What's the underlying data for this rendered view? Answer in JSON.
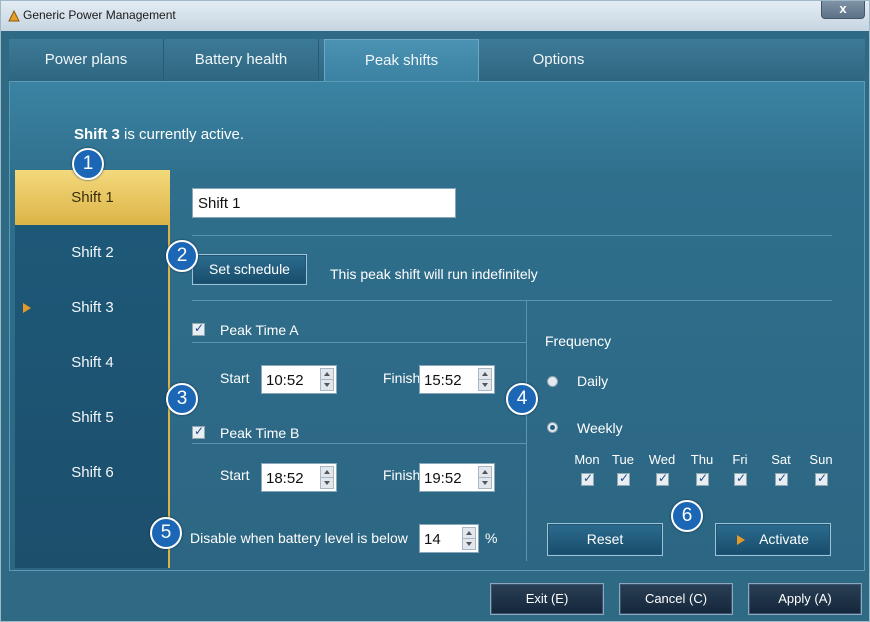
{
  "window": {
    "title": "Generic Power Management",
    "close_label": "x"
  },
  "tabs": [
    {
      "label": "Power plans"
    },
    {
      "label": "Battery health"
    },
    {
      "label": "Peak shifts"
    },
    {
      "label": "Options"
    }
  ],
  "status": {
    "shift_name": "Shift 3",
    "suffix": "is currently active."
  },
  "shifts": [
    {
      "label": "Shift 1"
    },
    {
      "label": "Shift 2"
    },
    {
      "label": "Shift 3"
    },
    {
      "label": "Shift 4"
    },
    {
      "label": "Shift 5"
    },
    {
      "label": "Shift 6"
    }
  ],
  "editor": {
    "name_value": "Shift 1",
    "set_schedule_label": "Set schedule",
    "schedule_note": "This peak shift will run indefinitely",
    "peak_a": {
      "label": "Peak Time A",
      "start_label": "Start",
      "start": "10:52",
      "finish_label": "Finish",
      "finish": "15:52"
    },
    "peak_b": {
      "label": "Peak Time B",
      "start_label": "Start",
      "start": "18:52",
      "finish_label": "Finish",
      "finish": "19:52"
    },
    "battery": {
      "label": "Disable when battery level is below",
      "value": "14",
      "unit": "%"
    },
    "frequency": {
      "label": "Frequency",
      "daily_label": "Daily",
      "weekly_label": "Weekly",
      "selected": "Weekly",
      "days": [
        "Mon",
        "Tue",
        "Wed",
        "Thu",
        "Fri",
        "Sat",
        "Sun"
      ]
    },
    "reset_label": "Reset",
    "activate_label": "Activate"
  },
  "footer": {
    "exit_label": "Exit (E)",
    "cancel_label": "Cancel (C)",
    "apply_label": "Apply (A)"
  },
  "callouts": [
    "1",
    "2",
    "3",
    "4",
    "5",
    "6"
  ],
  "colors": {
    "accent_gold": "#dcb447",
    "badge_blue": "#1c67b5",
    "panel_blue": "#2f6a85",
    "arrow_orange": "#e49a2a"
  }
}
